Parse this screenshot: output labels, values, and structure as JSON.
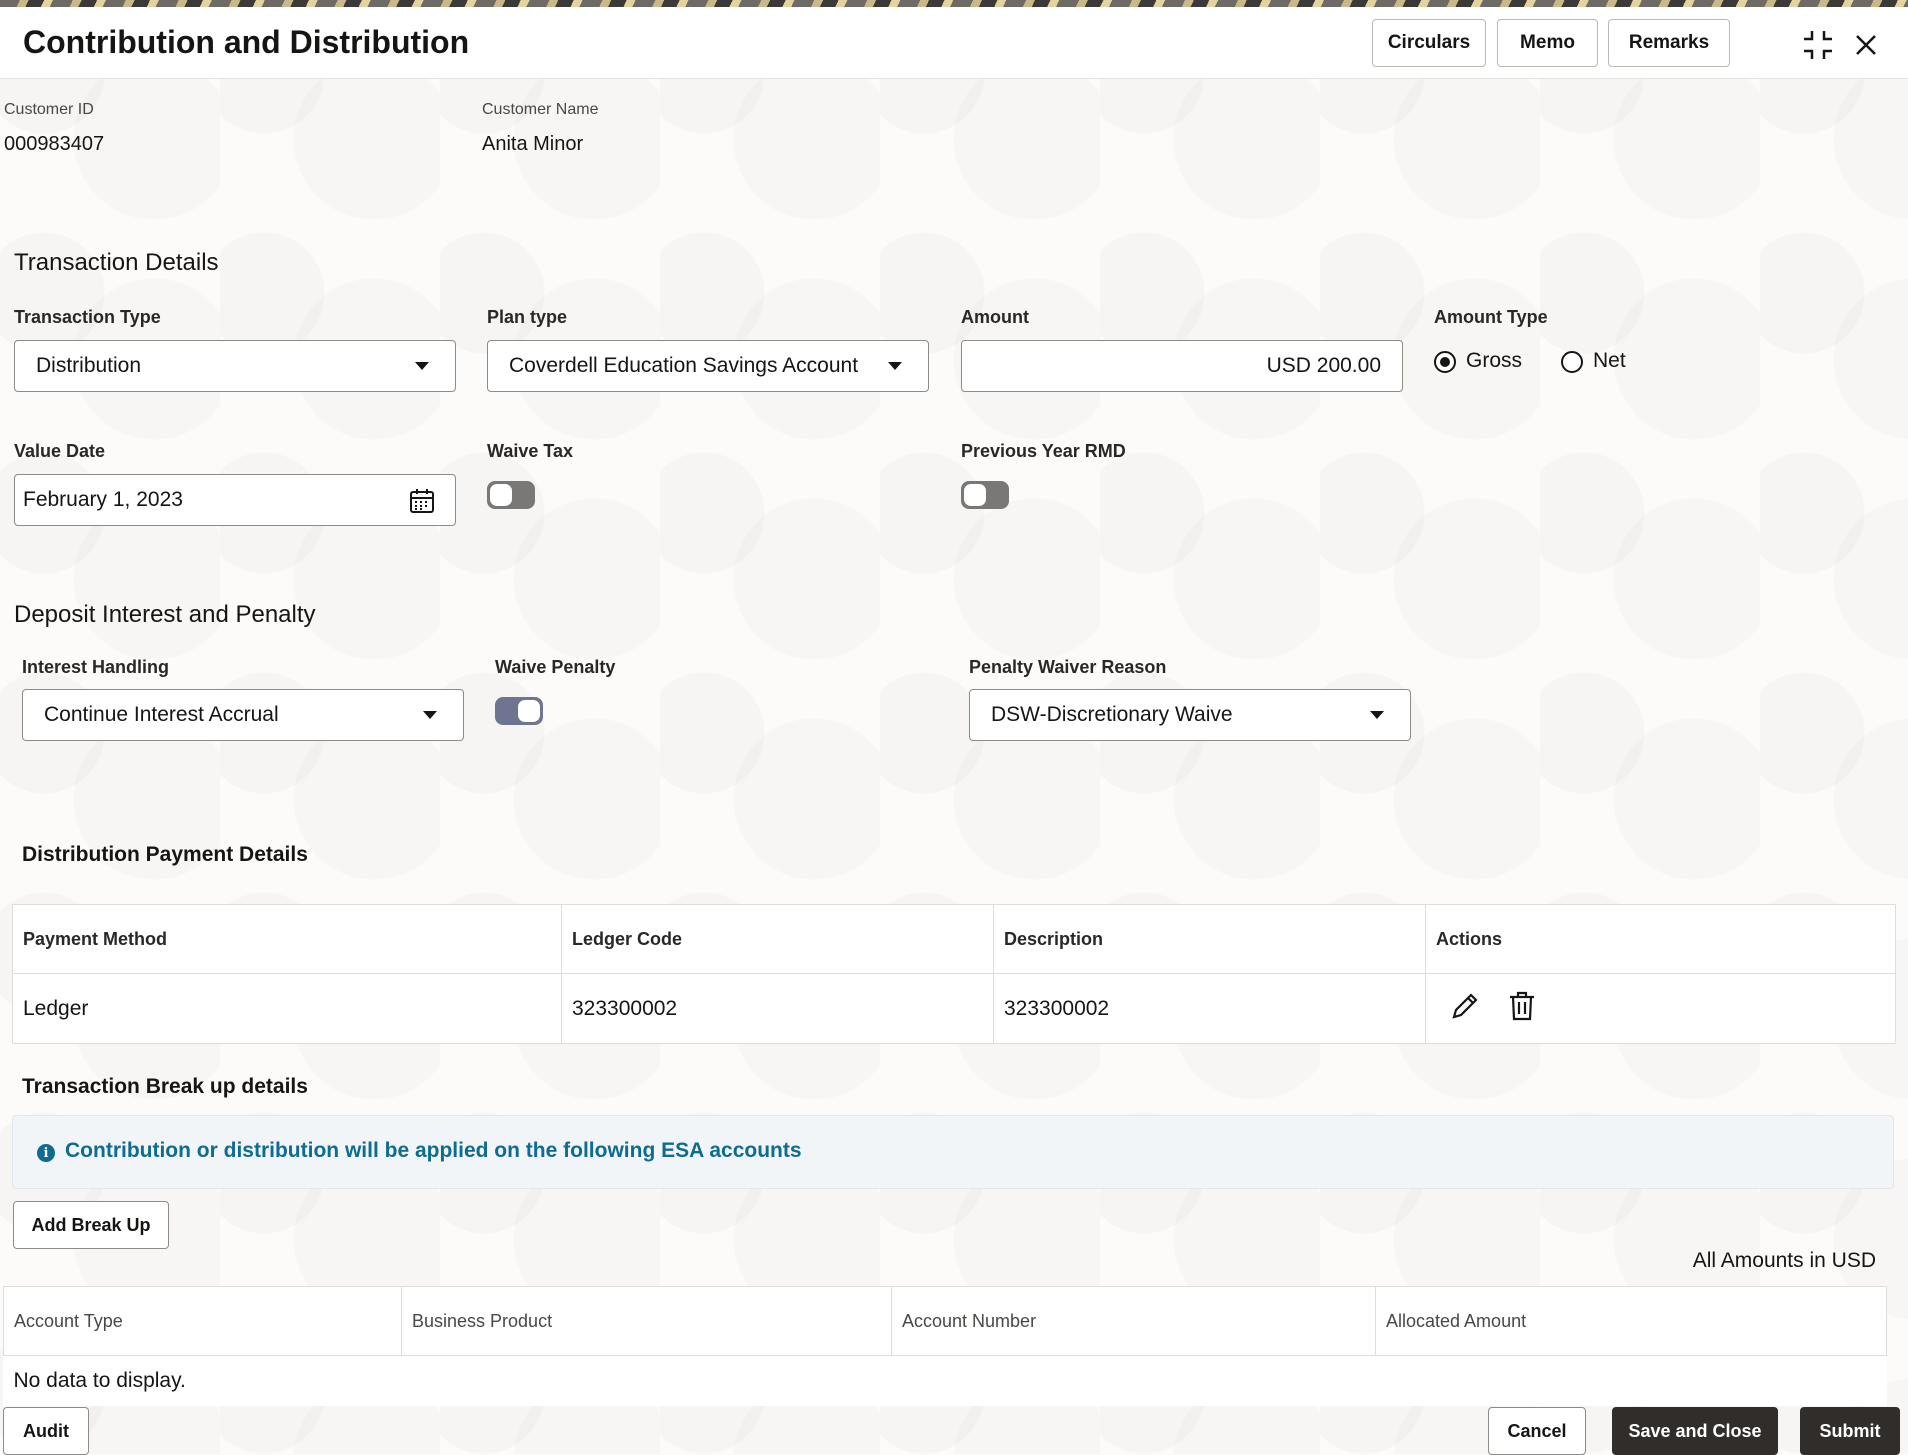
{
  "header": {
    "title": "Contribution and Distribution",
    "buttons": {
      "circulars": "Circulars",
      "memo": "Memo",
      "remarks": "Remarks"
    }
  },
  "customer": {
    "id_label": "Customer ID",
    "id_value": "000983407",
    "name_label": "Customer Name",
    "name_value": "Anita Minor"
  },
  "transaction_details": {
    "heading": "Transaction Details",
    "transaction_type": {
      "label": "Transaction Type",
      "value": "Distribution"
    },
    "plan_type": {
      "label": "Plan type",
      "value": "Coverdell Education Savings Account"
    },
    "amount": {
      "label": "Amount",
      "value": "USD 200.00"
    },
    "amount_type": {
      "label": "Amount Type",
      "options": [
        "Gross",
        "Net"
      ],
      "selected": "Gross"
    },
    "value_date": {
      "label": "Value Date",
      "value": "February 1, 2023"
    },
    "waive_tax": {
      "label": "Waive Tax",
      "on": false
    },
    "previous_year_rmd": {
      "label": "Previous Year RMD",
      "on": false
    }
  },
  "deposit_interest": {
    "heading": "Deposit Interest and Penalty",
    "interest_handling": {
      "label": "Interest Handling",
      "value": "Continue Interest Accrual"
    },
    "waive_penalty": {
      "label": "Waive Penalty",
      "on": true
    },
    "penalty_waiver_reason": {
      "label": "Penalty Waiver Reason",
      "value": "DSW-Discretionary Waive"
    }
  },
  "distribution_payment": {
    "heading": "Distribution Payment Details",
    "columns": [
      "Payment Method",
      "Ledger Code",
      "Description",
      "Actions"
    ],
    "rows": [
      {
        "payment_method": "Ledger",
        "ledger_code": "323300002",
        "description": "323300002"
      }
    ]
  },
  "breakup": {
    "heading": "Transaction Break up details",
    "info": "Contribution or distribution will be applied on the following ESA accounts",
    "add_button": "Add Break Up",
    "amounts_note": "All Amounts in USD",
    "columns": [
      "Account Type",
      "Business Product",
      "Account Number",
      "Allocated Amount"
    ],
    "empty_text": "No data to display."
  },
  "footer": {
    "audit": "Audit",
    "cancel": "Cancel",
    "save_close": "Save and Close",
    "submit": "Submit"
  },
  "colors": {
    "link_blue": "#0f6b8f",
    "dark_button": "#312d2a",
    "toggle_on": "#6f7591"
  }
}
